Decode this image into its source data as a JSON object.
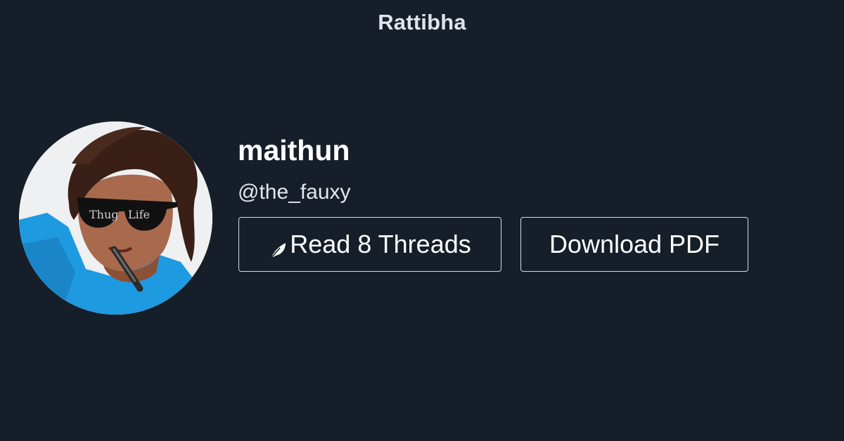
{
  "brand": {
    "title": "Rattibha"
  },
  "profile": {
    "display_name": "maithun",
    "handle": "@the_fauxy",
    "avatar_overlay_text_left": "Thug",
    "avatar_overlay_text_right": "Life"
  },
  "actions": {
    "read_label": "Read 8 Threads",
    "read_icon": "feather-icon",
    "download_label": "Download PDF"
  },
  "colors": {
    "background": "#161f29",
    "text": "#ffffff",
    "border": "#d6dbe0"
  }
}
